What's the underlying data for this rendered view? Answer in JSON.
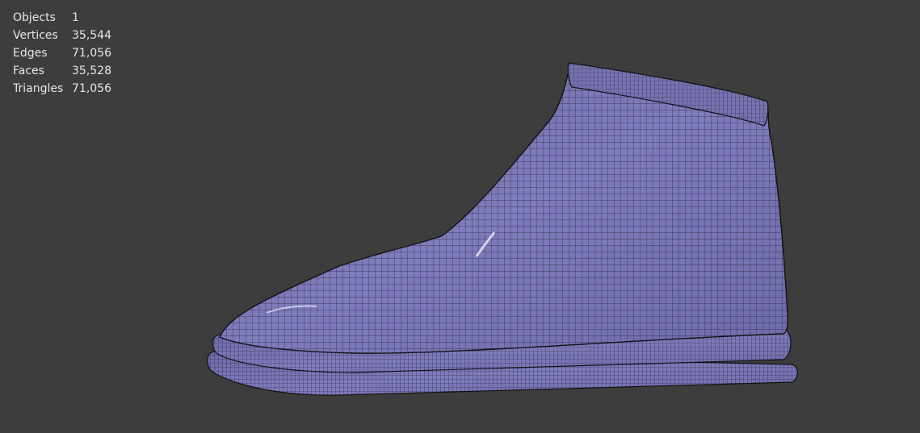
{
  "viewport": {
    "background_color": "#3d3d3d",
    "mesh_color": "#7e7bb8",
    "wire_color": "#1a1a2e",
    "stats": [
      {
        "label": "Objects",
        "value": "1"
      },
      {
        "label": "Vertices",
        "value": "35,544"
      },
      {
        "label": "Edges",
        "value": "71,056"
      },
      {
        "label": "Faces",
        "value": "35,528"
      },
      {
        "label": "Triangles",
        "value": "71,056"
      }
    ]
  }
}
